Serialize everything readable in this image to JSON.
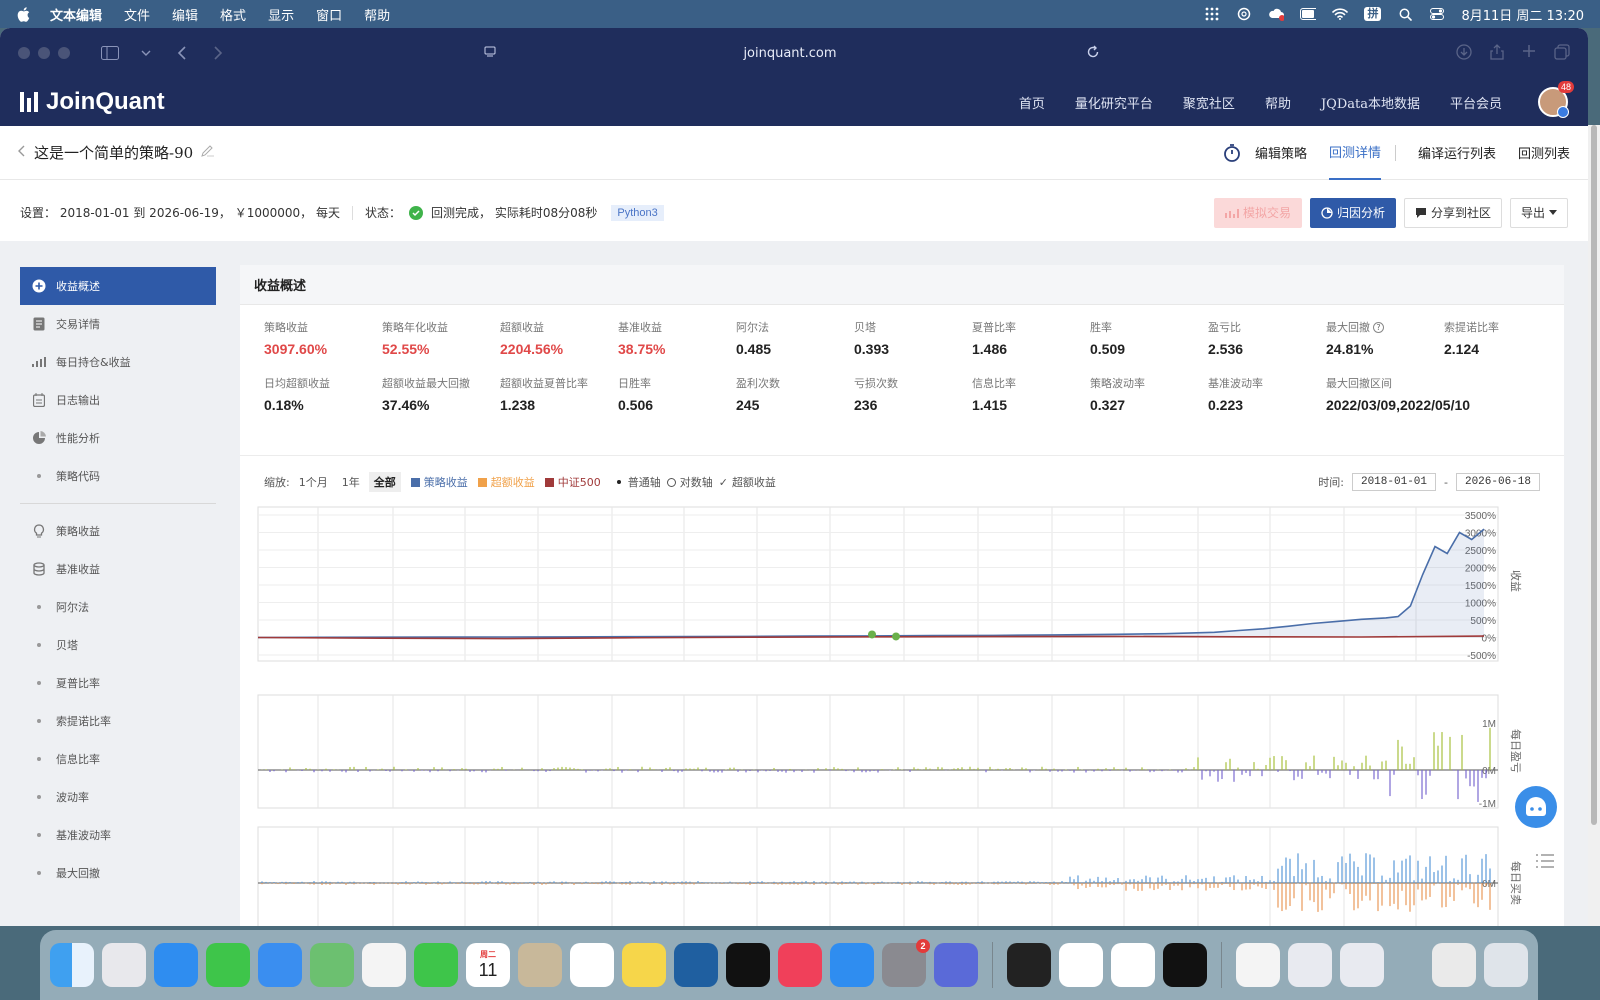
{
  "menubar": {
    "app": "文本编辑",
    "items": [
      "文件",
      "编辑",
      "格式",
      "显示",
      "窗口",
      "帮助"
    ],
    "ime": "拼",
    "datetime": "8月11日 周二 13:20"
  },
  "browser": {
    "url": "joinquant.com"
  },
  "site": {
    "logo": "JoinQuant",
    "nav": [
      "首页",
      "量化研究平台",
      "聚宽社区",
      "帮助",
      "JQData本地数据",
      "平台会员"
    ],
    "avatar_badge": "48"
  },
  "strategy": {
    "title": "这是一个简单的策略-90",
    "tabs": [
      {
        "label": "编辑策略",
        "active": false
      },
      {
        "label": "回测详情",
        "active": true
      },
      {
        "label": "编译运行列表",
        "active": false
      },
      {
        "label": "回测列表",
        "active": false
      }
    ]
  },
  "settings": {
    "text": "设置： 2018-01-01 到 2026-06-19， ￥1000000， 每天",
    "status_label": "状态：",
    "status": "回测完成， 实际耗时08分08秒",
    "python": "Python3",
    "buttons": {
      "sim_trade": "模拟交易",
      "attribution": "归因分析",
      "share": "分享到社区",
      "export": "导出"
    }
  },
  "sidebar": {
    "group1": [
      {
        "label": "收益概述",
        "icon": "plus-circle-icon",
        "active": true
      },
      {
        "label": "交易详情",
        "icon": "doc-icon"
      },
      {
        "label": "每日持仓&收益",
        "icon": "bar-chart-icon"
      },
      {
        "label": "日志输出",
        "icon": "calendar-icon"
      },
      {
        "label": "性能分析",
        "icon": "pie-icon"
      },
      {
        "label": "策略代码",
        "icon": "dot"
      }
    ],
    "group2": [
      {
        "label": "策略收益",
        "icon": "bulb-icon"
      },
      {
        "label": "基准收益",
        "icon": "database-icon"
      },
      {
        "label": "阿尔法",
        "icon": "dot"
      },
      {
        "label": "贝塔",
        "icon": "dot"
      },
      {
        "label": "夏普比率",
        "icon": "dot"
      },
      {
        "label": "索提诺比率",
        "icon": "dot"
      },
      {
        "label": "信息比率",
        "icon": "dot"
      },
      {
        "label": "波动率",
        "icon": "dot"
      },
      {
        "label": "基准波动率",
        "icon": "dot"
      },
      {
        "label": "最大回撤",
        "icon": "dot"
      }
    ]
  },
  "panel": {
    "title": "收益概述",
    "metrics_row1": [
      {
        "label": "策略收益",
        "value": "3097.60%",
        "red": true
      },
      {
        "label": "策略年化收益",
        "value": "52.55%",
        "red": true
      },
      {
        "label": "超额收益",
        "value": "2204.56%",
        "red": true
      },
      {
        "label": "基准收益",
        "value": "38.75%",
        "red": true
      },
      {
        "label": "阿尔法",
        "value": "0.485"
      },
      {
        "label": "贝塔",
        "value": "0.393"
      },
      {
        "label": "夏普比率",
        "value": "1.486"
      },
      {
        "label": "胜率",
        "value": "0.509"
      },
      {
        "label": "盈亏比",
        "value": "2.536"
      },
      {
        "label": "最大回撤",
        "value": "24.81%",
        "help": true
      },
      {
        "label": "索提诺比率",
        "value": "2.124"
      }
    ],
    "metrics_row2": [
      {
        "label": "日均超额收益",
        "value": "0.18%"
      },
      {
        "label": "超额收益最大回撤",
        "value": "37.46%"
      },
      {
        "label": "超额收益夏普比率",
        "value": "1.238"
      },
      {
        "label": "日胜率",
        "value": "0.506"
      },
      {
        "label": "盈利次数",
        "value": "245"
      },
      {
        "label": "亏损次数",
        "value": "236"
      },
      {
        "label": "信息比率",
        "value": "1.415"
      },
      {
        "label": "策略波动率",
        "value": "0.327"
      },
      {
        "label": "基准波动率",
        "value": "0.223"
      },
      {
        "label": "最大回撤区间",
        "value": "2022/03/09,2022/05/10"
      }
    ]
  },
  "controls": {
    "zoom_label": "缩放:",
    "zoom": [
      "1个月",
      "1年",
      "全部"
    ],
    "zoom_active": 2,
    "legend": [
      {
        "label": "策略收益",
        "color": "#4a6ea9"
      },
      {
        "label": "超额收益",
        "color": "#f0a14a"
      },
      {
        "label": "中证500",
        "color": "#a03a3a"
      }
    ],
    "axis_options": [
      {
        "label": "普通轴",
        "type": "dot"
      },
      {
        "label": "对数轴",
        "type": "radio"
      },
      {
        "label": "超额收益",
        "type": "check"
      }
    ],
    "time_label": "时间:",
    "start": "2018-01-01",
    "end": "2026-06-18",
    "dash": "-"
  },
  "chart_data": {
    "type": "line",
    "title": "",
    "ylabel": "收益",
    "yticks": [
      "3500%",
      "3000%",
      "2500%",
      "2000%",
      "1500%",
      "1000%",
      "500%",
      "0%",
      "-500%"
    ],
    "ylim": [
      -500,
      3500
    ],
    "series": [
      {
        "name": "策略收益",
        "color": "#4a6ea9",
        "points": [
          [
            0,
            0
          ],
          [
            0.05,
            5
          ],
          [
            0.1,
            8
          ],
          [
            0.15,
            12
          ],
          [
            0.2,
            15
          ],
          [
            0.25,
            18
          ],
          [
            0.3,
            22
          ],
          [
            0.35,
            28
          ],
          [
            0.4,
            32
          ],
          [
            0.45,
            40
          ],
          [
            0.5,
            45
          ],
          [
            0.55,
            55
          ],
          [
            0.6,
            60
          ],
          [
            0.65,
            75
          ],
          [
            0.7,
            90
          ],
          [
            0.74,
            110
          ],
          [
            0.78,
            150
          ],
          [
            0.8,
            200
          ],
          [
            0.82,
            250
          ],
          [
            0.84,
            320
          ],
          [
            0.86,
            400
          ],
          [
            0.88,
            460
          ],
          [
            0.9,
            520
          ],
          [
            0.92,
            560
          ],
          [
            0.93,
            600
          ],
          [
            0.94,
            900
          ],
          [
            0.95,
            1800
          ],
          [
            0.96,
            2600
          ],
          [
            0.97,
            2400
          ],
          [
            0.98,
            3000
          ],
          [
            0.99,
            2800
          ],
          [
            1.0,
            3097.6
          ]
        ]
      },
      {
        "name": "中证500",
        "color": "#a03a3a",
        "points": [
          [
            0,
            0
          ],
          [
            0.1,
            -20
          ],
          [
            0.2,
            -30
          ],
          [
            0.3,
            -10
          ],
          [
            0.4,
            10
          ],
          [
            0.5,
            20
          ],
          [
            0.6,
            25
          ],
          [
            0.7,
            30
          ],
          [
            0.8,
            20
          ],
          [
            0.9,
            15
          ],
          [
            1.0,
            38.75
          ]
        ]
      }
    ],
    "sub_charts": [
      {
        "ylabel": "每日盈亏",
        "yticks": [
          "1M",
          "0M",
          "-1M"
        ]
      },
      {
        "ylabel": "每日买卖",
        "yticks": [
          "0M"
        ]
      }
    ]
  },
  "dock": {
    "calendar_day": "11",
    "calendar_weekday": "周二",
    "settings_badge": "2"
  }
}
